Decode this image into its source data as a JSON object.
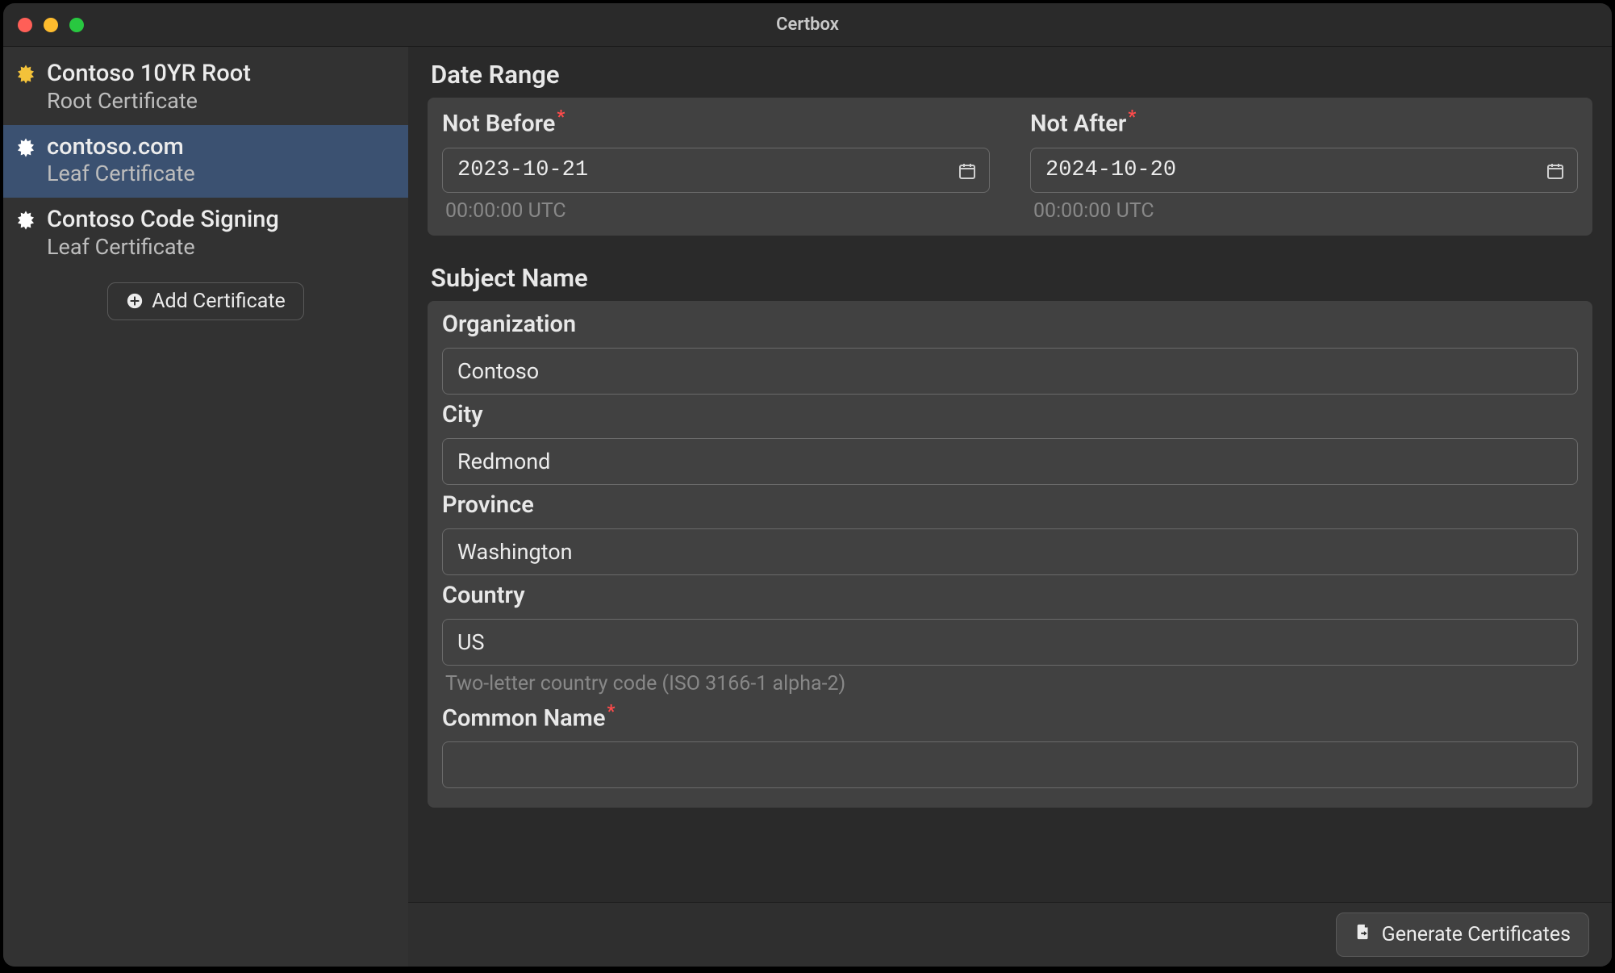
{
  "window": {
    "title": "Certbox"
  },
  "sidebar": {
    "items": [
      {
        "name": "Contoso 10YR Root",
        "type": "Root Certificate",
        "selected": false,
        "iconColor": "#f3c23a"
      },
      {
        "name": "contoso.com",
        "type": "Leaf Certificate",
        "selected": true,
        "iconColor": "#ffffff"
      },
      {
        "name": "Contoso Code Signing",
        "type": "Leaf Certificate",
        "selected": false,
        "iconColor": "#ffffff"
      }
    ],
    "add_label": "Add Certificate"
  },
  "form": {
    "date_range": {
      "heading": "Date Range",
      "not_before": {
        "label": "Not Before",
        "value": "2023-10-21",
        "hint": "00:00:00 UTC"
      },
      "not_after": {
        "label": "Not After",
        "value": "2024-10-20",
        "hint": "00:00:00 UTC"
      }
    },
    "subject": {
      "heading": "Subject Name",
      "organization": {
        "label": "Organization",
        "value": "Contoso"
      },
      "city": {
        "label": "City",
        "value": "Redmond"
      },
      "province": {
        "label": "Province",
        "value": "Washington"
      },
      "country": {
        "label": "Country",
        "value": "US",
        "hint": "Two-letter country code (ISO 3166-1 alpha-2)"
      },
      "common_name": {
        "label": "Common Name",
        "value": ""
      }
    }
  },
  "footer": {
    "generate_label": "Generate Certificates"
  },
  "required_marker": "*"
}
